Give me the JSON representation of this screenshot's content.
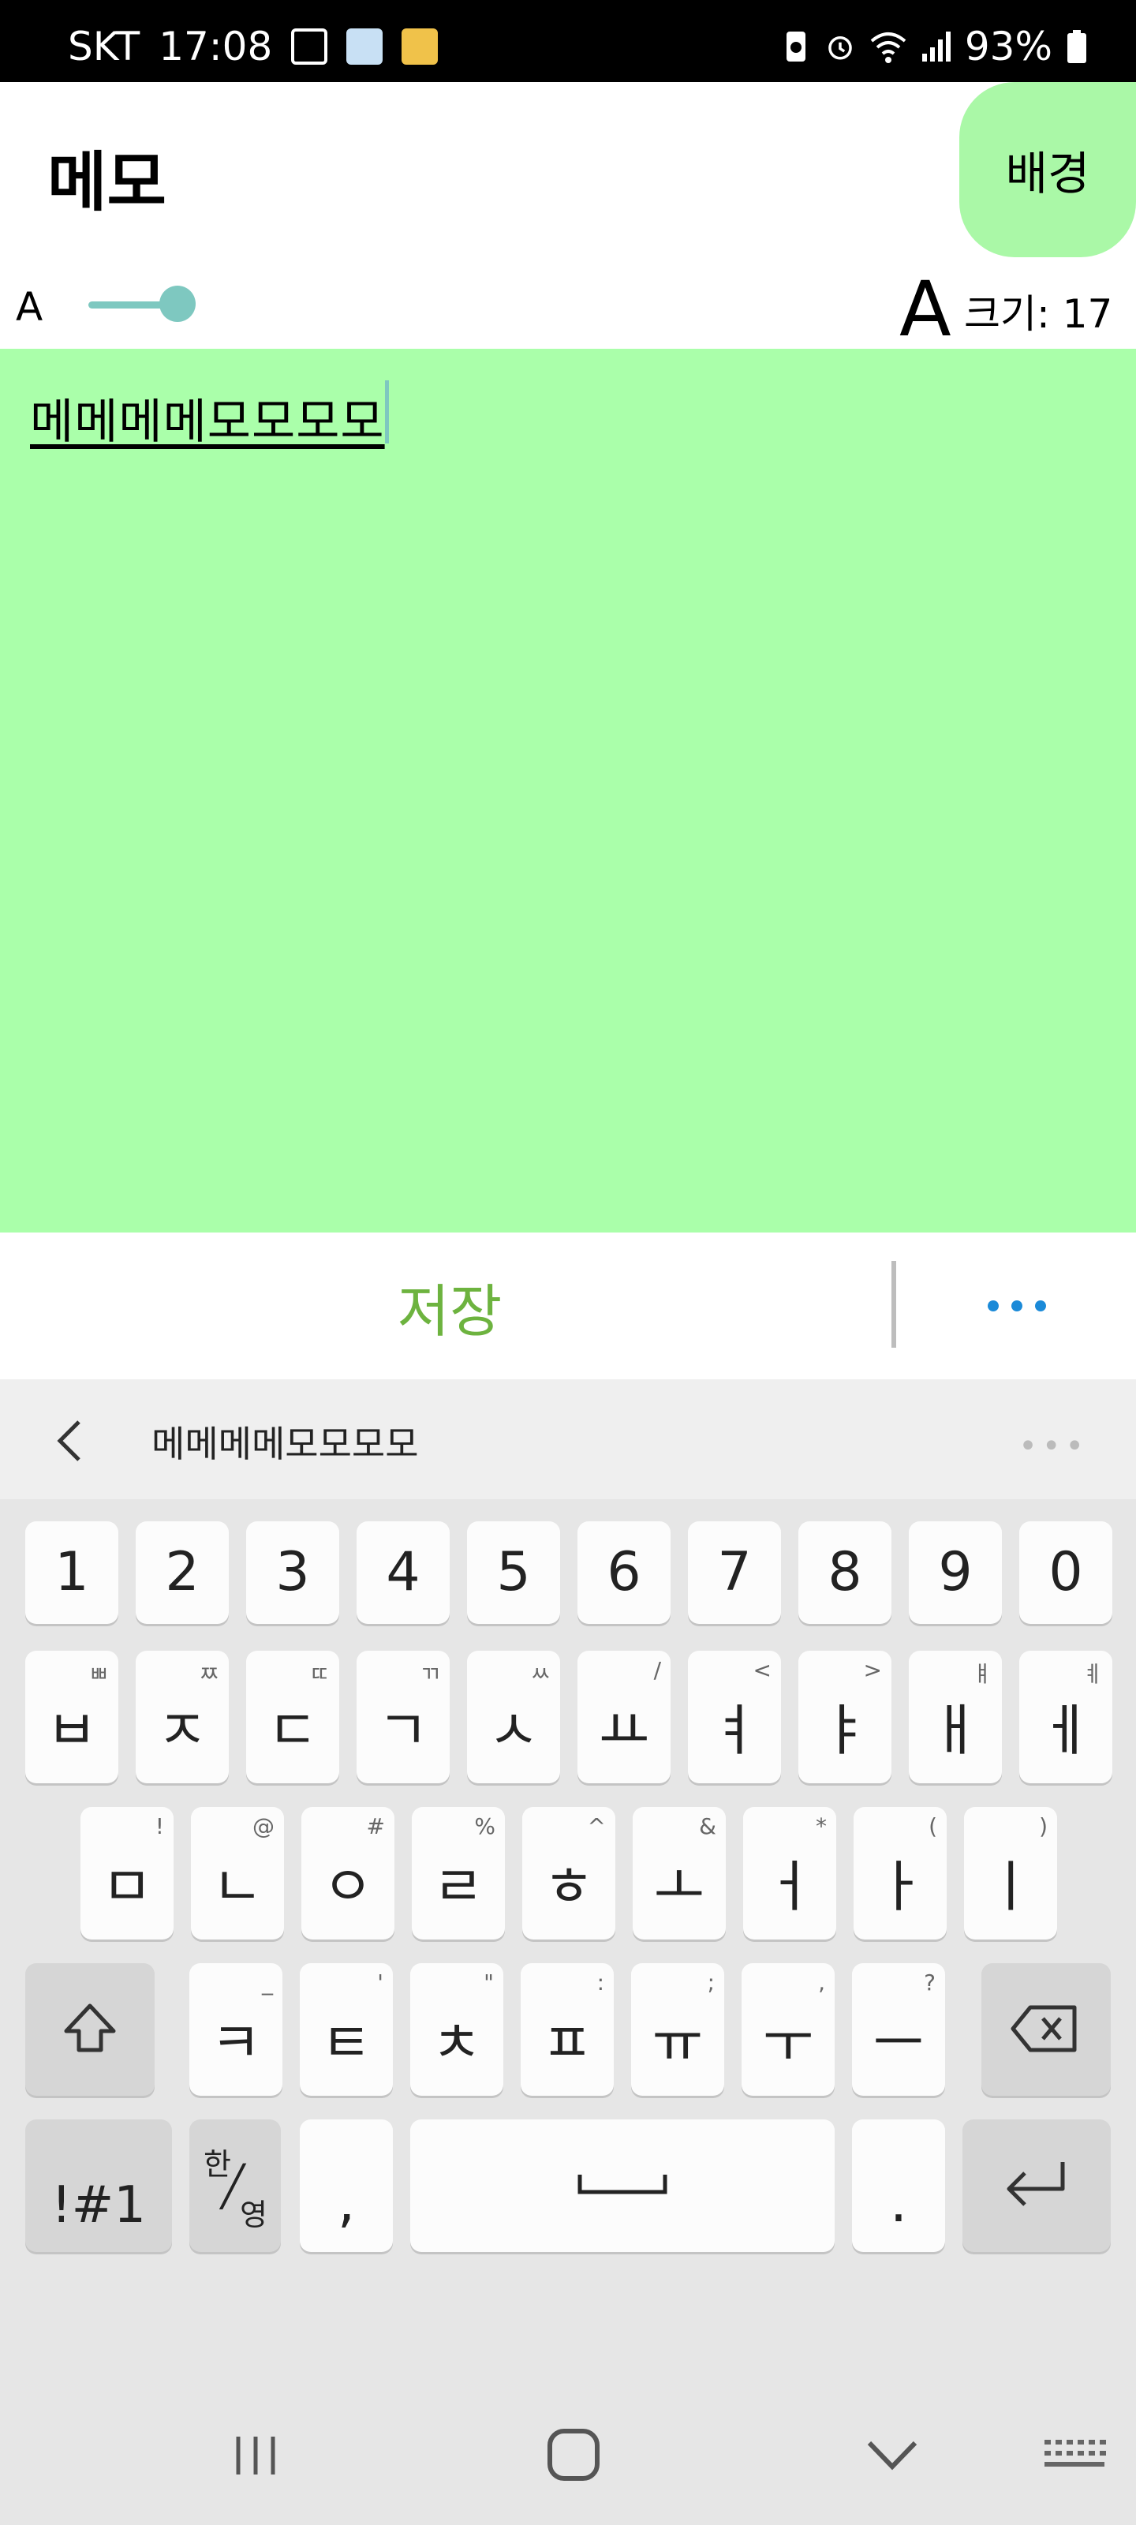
{
  "status_bar": {
    "carrier": "SKT",
    "time": "17:08",
    "battery": "93%"
  },
  "header": {
    "title": "메모",
    "background_button": "배경"
  },
  "font_size": {
    "small_a": "A",
    "large_a": "A",
    "label": "크기: 17",
    "value": 17
  },
  "memo": {
    "text": "메메메메모모모모"
  },
  "actions": {
    "save_label": "저장"
  },
  "keyboard": {
    "suggestion": "메메메메모모모모",
    "number_row": [
      "1",
      "2",
      "3",
      "4",
      "5",
      "6",
      "7",
      "8",
      "9",
      "0"
    ],
    "row1": [
      {
        "main": "ㅂ",
        "sub": "ㅃ"
      },
      {
        "main": "ㅈ",
        "sub": "ㅉ"
      },
      {
        "main": "ㄷ",
        "sub": "ㄸ"
      },
      {
        "main": "ㄱ",
        "sub": "ㄲ"
      },
      {
        "main": "ㅅ",
        "sub": "ㅆ"
      },
      {
        "main": "ㅛ",
        "sub": "/"
      },
      {
        "main": "ㅕ",
        "sub": "<"
      },
      {
        "main": "ㅑ",
        "sub": ">"
      },
      {
        "main": "ㅐ",
        "sub": "ㅒ"
      },
      {
        "main": "ㅔ",
        "sub": "ㅖ"
      }
    ],
    "row2": [
      {
        "main": "ㅁ",
        "sub": "!"
      },
      {
        "main": "ㄴ",
        "sub": "@"
      },
      {
        "main": "ㅇ",
        "sub": "#"
      },
      {
        "main": "ㄹ",
        "sub": "%"
      },
      {
        "main": "ㅎ",
        "sub": "^"
      },
      {
        "main": "ㅗ",
        "sub": "&"
      },
      {
        "main": "ㅓ",
        "sub": "*"
      },
      {
        "main": "ㅏ",
        "sub": "("
      },
      {
        "main": "ㅣ",
        "sub": ")"
      }
    ],
    "row3": [
      {
        "main": "ㅋ",
        "sub": "_"
      },
      {
        "main": "ㅌ",
        "sub": "'"
      },
      {
        "main": "ㅊ",
        "sub": "\""
      },
      {
        "main": "ㅍ",
        "sub": ":"
      },
      {
        "main": "ㅠ",
        "sub": ";"
      },
      {
        "main": "ㅜ",
        "sub": ","
      },
      {
        "main": "ㅡ",
        "sub": "?"
      }
    ],
    "symbols_key": "!#1",
    "lang_key_top": "한",
    "lang_key_bottom": "영",
    "comma_key": ",",
    "period_key": "."
  }
}
